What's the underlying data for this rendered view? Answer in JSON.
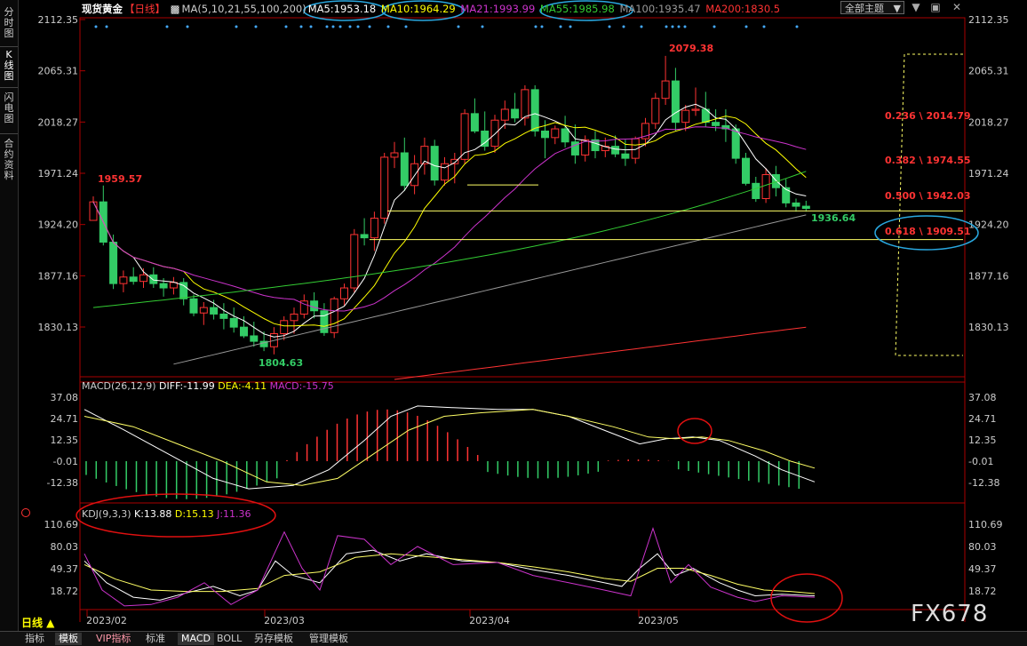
{
  "sidebar": {
    "items": [
      {
        "label": "分时图"
      },
      {
        "label": "K线图"
      },
      {
        "label": "闪电图"
      },
      {
        "label": "合约资料"
      }
    ]
  },
  "header": {
    "symbol": "现货黄金",
    "period_tag": "【日线】",
    "ma_title": "MA(5,10,21,55,100,200)",
    "ma5": "MA5:1953.18",
    "ma10": "MA10:1964.29",
    "ma21": "MA21:1993.99",
    "ma55": "MA55:1985.98",
    "ma100": "MA100:1935.47",
    "ma200": "MA200:1830.5",
    "theme_button": "全部主题",
    "colors": {
      "ma5": "#ffffff",
      "ma10": "#ffff00",
      "ma21": "#cc33cc",
      "ma55": "#33cc33",
      "ma100": "#999999",
      "ma200": "#ff3333"
    }
  },
  "macd_legend": {
    "title": "MACD(26,12,9)",
    "diff": "DIFF:-11.99",
    "dea": "DEA:-4.11",
    "macd": "MACD:-15.75"
  },
  "kdj_legend": {
    "title": "KDJ(9,3,3)",
    "k": "K:13.88",
    "d": "D:15.13",
    "j": "J:11.36"
  },
  "price_axis": [
    "2112.35",
    "2065.31",
    "2018.27",
    "1971.24",
    "1924.20",
    "1877.16",
    "1830.13"
  ],
  "macd_axis": [
    "37.08",
    "24.71",
    "12.35",
    "-0.01",
    "-12.38"
  ],
  "kdj_axis": [
    "110.69",
    "80.03",
    "49.37",
    "18.72"
  ],
  "date_axis": [
    "2023/02",
    "2023/03",
    "2023/04",
    "2023/05"
  ],
  "annotations": {
    "high_feb": "1959.57",
    "low_feb": "1804.63",
    "high_may": "2079.38",
    "last_low": "1936.64"
  },
  "fibonacci": [
    {
      "label": "0.236 \\ 2014.79"
    },
    {
      "label": "0.382 \\ 1974.55"
    },
    {
      "label": "0.500 \\ 1942.03"
    },
    {
      "label": "0.618 \\ 1909.51"
    }
  ],
  "chart_data": {
    "type": "candlestick",
    "title": "现货黄金【日线】",
    "ylim": [
      1790,
      2112.35
    ],
    "candles": [
      [
        1928,
        1950,
        1931,
        1945
      ],
      [
        1945,
        1960,
        1905,
        1908
      ],
      [
        1908,
        1915,
        1865,
        1870
      ],
      [
        1870,
        1882,
        1862,
        1876
      ],
      [
        1876,
        1885,
        1869,
        1872
      ],
      [
        1872,
        1884,
        1866,
        1878
      ],
      [
        1878,
        1885,
        1866,
        1870
      ],
      [
        1870,
        1875,
        1858,
        1866
      ],
      [
        1866,
        1876,
        1860,
        1871
      ],
      [
        1871,
        1875,
        1850,
        1856
      ],
      [
        1856,
        1860,
        1840,
        1843
      ],
      [
        1843,
        1853,
        1832,
        1848
      ],
      [
        1848,
        1855,
        1837,
        1842
      ],
      [
        1842,
        1852,
        1828,
        1838
      ],
      [
        1838,
        1848,
        1825,
        1830
      ],
      [
        1830,
        1840,
        1820,
        1822
      ],
      [
        1822,
        1835,
        1812,
        1817
      ],
      [
        1817,
        1826,
        1808,
        1812
      ],
      [
        1812,
        1830,
        1805,
        1824
      ],
      [
        1824,
        1840,
        1818,
        1836
      ],
      [
        1836,
        1848,
        1824,
        1842
      ],
      [
        1842,
        1860,
        1838,
        1854
      ],
      [
        1854,
        1862,
        1838,
        1845
      ],
      [
        1845,
        1852,
        1822,
        1825
      ],
      [
        1825,
        1858,
        1820,
        1856
      ],
      [
        1856,
        1870,
        1850,
        1866
      ],
      [
        1866,
        1920,
        1862,
        1915
      ],
      [
        1915,
        1930,
        1905,
        1912
      ],
      [
        1912,
        1936,
        1900,
        1930
      ],
      [
        1930,
        1990,
        1925,
        1986
      ],
      [
        1986,
        2000,
        1976,
        1990
      ],
      [
        1990,
        2004,
        1955,
        1960
      ],
      [
        1960,
        1988,
        1952,
        1980
      ],
      [
        1980,
        2004,
        1970,
        1996
      ],
      [
        1996,
        2002,
        1960,
        1965
      ],
      [
        1965,
        1986,
        1960,
        1980
      ],
      [
        1980,
        1990,
        1962,
        1984
      ],
      [
        1984,
        2030,
        1980,
        2026
      ],
      [
        2026,
        2040,
        2008,
        2010
      ],
      [
        2010,
        2028,
        1992,
        1996
      ],
      [
        1996,
        2025,
        1990,
        2020
      ],
      [
        2020,
        2038,
        2012,
        2030
      ],
      [
        2030,
        2045,
        2018,
        2022
      ],
      [
        2022,
        2052,
        2015,
        2048
      ],
      [
        2048,
        2052,
        2005,
        2010
      ],
      [
        2010,
        2020,
        1985,
        2004
      ],
      [
        2004,
        2015,
        1998,
        2012
      ],
      [
        2012,
        2024,
        1995,
        2000
      ],
      [
        2000,
        2016,
        1980,
        1988
      ],
      [
        1988,
        2006,
        1982,
        2002
      ],
      [
        2002,
        2010,
        1985,
        1992
      ],
      [
        1992,
        2004,
        1986,
        1996
      ],
      [
        1996,
        2006,
        1986,
        1989
      ],
      [
        1989,
        2002,
        1978,
        1985
      ],
      [
        1985,
        2005,
        1980,
        2003
      ],
      [
        2003,
        2022,
        1996,
        2017
      ],
      [
        2017,
        2045,
        2012,
        2040
      ],
      [
        2040,
        2079,
        2034,
        2056
      ],
      [
        2056,
        2068,
        2010,
        2018
      ],
      [
        2018,
        2034,
        2010,
        2029
      ],
      [
        2029,
        2050,
        2024,
        2030
      ],
      [
        2030,
        2046,
        2014,
        2018
      ],
      [
        2018,
        2030,
        2010,
        2015
      ],
      [
        2015,
        2030,
        2000,
        2012
      ],
      [
        2012,
        2016,
        1980,
        1985
      ],
      [
        1985,
        1990,
        1960,
        1962
      ],
      [
        1962,
        1968,
        1945,
        1948
      ],
      [
        1948,
        1976,
        1944,
        1970
      ],
      [
        1970,
        1978,
        1950,
        1958
      ],
      [
        1958,
        1966,
        1940,
        1944
      ],
      [
        1944,
        1948,
        1936,
        1941
      ],
      [
        1941,
        1946,
        1936,
        1939
      ]
    ]
  }
}
